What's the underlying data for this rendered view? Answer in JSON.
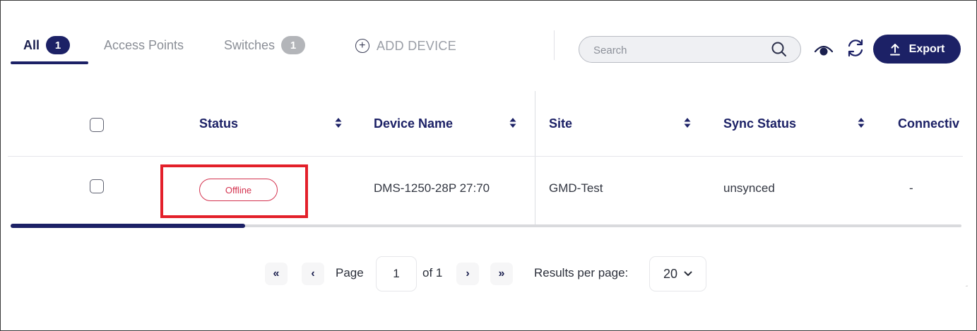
{
  "tabs": [
    {
      "label": "All",
      "count": "1",
      "active": true
    },
    {
      "label": "Access Points",
      "count": "",
      "active": false
    },
    {
      "label": "Switches",
      "count": "1",
      "active": false
    }
  ],
  "add_device_label": "ADD DEVICE",
  "search": {
    "placeholder": "Search"
  },
  "export_label": "Export",
  "colors": {
    "brand": "#1c2166",
    "offline": "#d4334f",
    "highlight": "#e3202a",
    "muted": "#8a8e96"
  },
  "icons": [
    "plus-circle-icon",
    "search-icon",
    "eye-icon",
    "refresh-icon",
    "upload-icon",
    "sort-icon",
    "chevron-down-icon"
  ],
  "table": {
    "columns": [
      "Status",
      "Device Name",
      "Site",
      "Sync Status",
      "Connectiv"
    ],
    "rows": [
      {
        "status": "Offline",
        "device_name": "DMS-1250-28P 27:70",
        "site": "GMD-Test",
        "sync_status": "unsynced",
        "connectivity": "-"
      }
    ]
  },
  "pagination": {
    "first": "«",
    "prev": "‹",
    "page_label": "Page",
    "current_page": "1",
    "of_label": "of 1",
    "next": "›",
    "last": "»",
    "results_label": "Results per page:",
    "per_page": "20"
  }
}
